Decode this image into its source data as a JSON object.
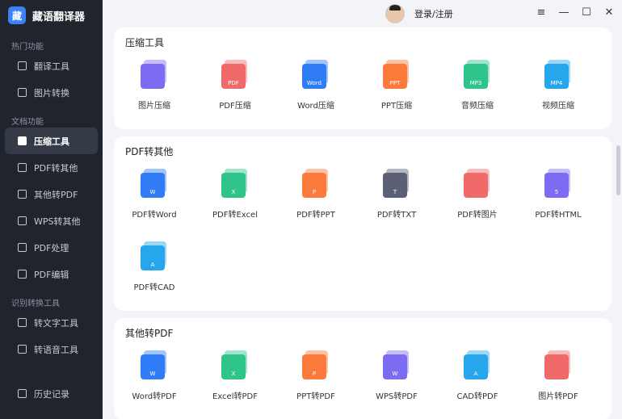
{
  "app": {
    "logo_text": "藏",
    "name": "藏语翻译器"
  },
  "header": {
    "login_label": "登录/注册",
    "menu_icon": "≡",
    "min_icon": "—",
    "max_icon": "☐",
    "close_icon": "✕"
  },
  "sidebar": {
    "sec1": "热门功能",
    "sec2": "文档功能",
    "sec3": "识别转换工具",
    "items": [
      {
        "label": "翻译工具"
      },
      {
        "label": "图片转换"
      },
      {
        "label": "压缩工具"
      },
      {
        "label": "PDF转其他"
      },
      {
        "label": "其他转PDF"
      },
      {
        "label": "WPS转其他"
      },
      {
        "label": "PDF处理"
      },
      {
        "label": "PDF编辑"
      },
      {
        "label": "转文字工具"
      },
      {
        "label": "转语音工具"
      },
      {
        "label": "历史记录"
      }
    ]
  },
  "sections": [
    {
      "title": "压缩工具",
      "tools": [
        {
          "label": "图片压缩",
          "badge": "",
          "color": "#7c6cf2"
        },
        {
          "label": "PDF压缩",
          "badge": "PDF",
          "color": "#f06a6a"
        },
        {
          "label": "Word压缩",
          "badge": "Word",
          "color": "#2f7cf6"
        },
        {
          "label": "PPT压缩",
          "badge": "PPT",
          "color": "#fb7a3c"
        },
        {
          "label": "音频压缩",
          "badge": "MP3",
          "color": "#2ec48a"
        },
        {
          "label": "视频压缩",
          "badge": "MP4",
          "color": "#27a6ee"
        }
      ]
    },
    {
      "title": "PDF转其他",
      "tools": [
        {
          "label": "PDF转Word",
          "badge": "W",
          "color": "#2f7cf6"
        },
        {
          "label": "PDF转Excel",
          "badge": "X",
          "color": "#2ec48a"
        },
        {
          "label": "PDF转PPT",
          "badge": "P",
          "color": "#fb7a3c"
        },
        {
          "label": "PDF转TXT",
          "badge": "T",
          "color": "#5b6075"
        },
        {
          "label": "PDF转图片",
          "badge": "",
          "color": "#f06a6a"
        },
        {
          "label": "PDF转HTML",
          "badge": "5",
          "color": "#7c6cf2"
        },
        {
          "label": "PDF转CAD",
          "badge": "A",
          "color": "#27a6ee"
        }
      ]
    },
    {
      "title": "其他转PDF",
      "tools": [
        {
          "label": "Word转PDF",
          "badge": "W",
          "color": "#2f7cf6"
        },
        {
          "label": "Excel转PDF",
          "badge": "X",
          "color": "#2ec48a"
        },
        {
          "label": "PPT转PDF",
          "badge": "P",
          "color": "#fb7a3c"
        },
        {
          "label": "WPS转PDF",
          "badge": "W",
          "color": "#7c6cf2"
        },
        {
          "label": "CAD转PDF",
          "badge": "A",
          "color": "#27a6ee"
        },
        {
          "label": "图片转PDF",
          "badge": "",
          "color": "#f06a6a"
        }
      ]
    }
  ]
}
